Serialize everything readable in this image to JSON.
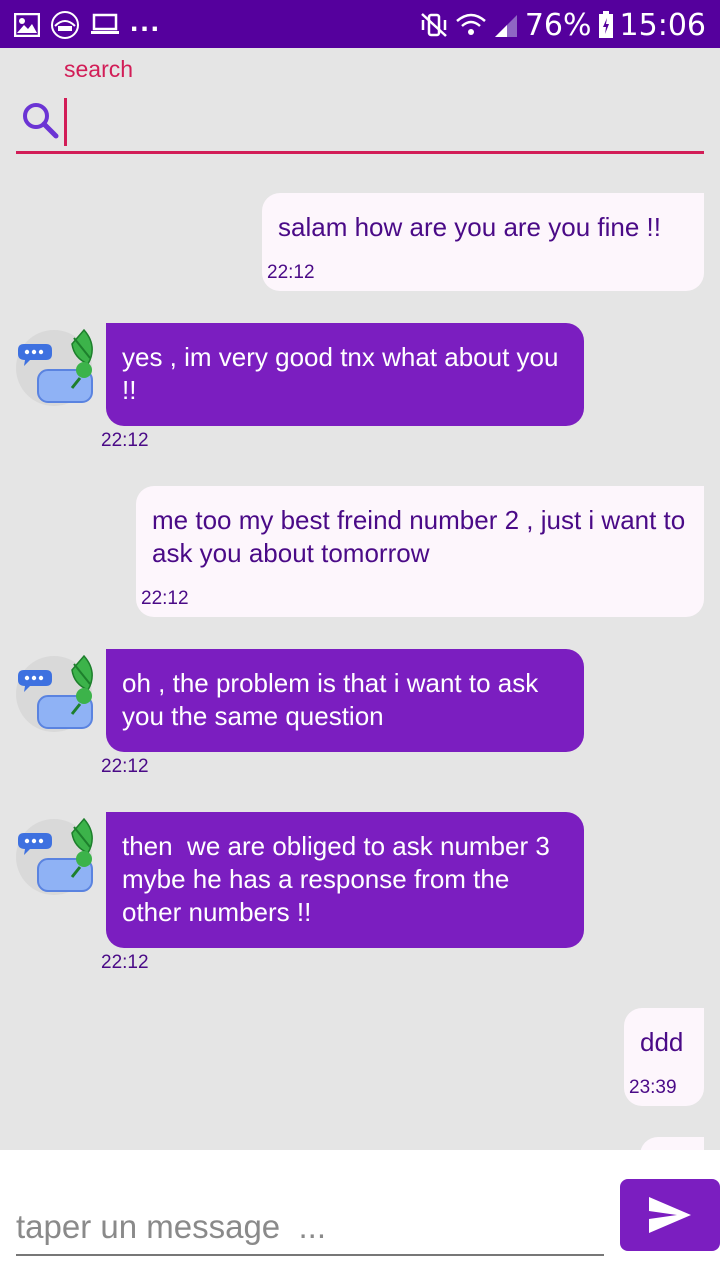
{
  "status_bar": {
    "battery_percent": "76%",
    "time": "15:06",
    "overflow": "...",
    "background_color": "#55009d"
  },
  "search": {
    "label": "search",
    "value": "",
    "accent_color": "#d21d57"
  },
  "messages": [
    {
      "direction": "sent",
      "text": "salam how are you are you fine !!",
      "time": "22:12"
    },
    {
      "direction": "received",
      "text": "yes , im very good tnx what about you !!",
      "time": "22:12"
    },
    {
      "direction": "sent",
      "text": "me too my best freind number 2 , just i want to ask you about tomorrow",
      "time": "22:12"
    },
    {
      "direction": "received",
      "text": "oh , the problem is that i want to ask you the same question",
      "time": "22:12"
    },
    {
      "direction": "received",
      "text": "then  we are obliged to ask number 3 mybe he has a response from the other numbers !!",
      "time": "22:12"
    },
    {
      "direction": "sent",
      "text": "ddd",
      "time": "23:39"
    }
  ],
  "composer": {
    "placeholder": "taper un message  ...",
    "value": "",
    "send_icon": "send-icon"
  },
  "colors": {
    "sent_bubble": "#fdf6fc",
    "received_bubble": "#7b1ec0",
    "sent_text": "#4a0a87",
    "timestamp": "#4a0a87"
  }
}
